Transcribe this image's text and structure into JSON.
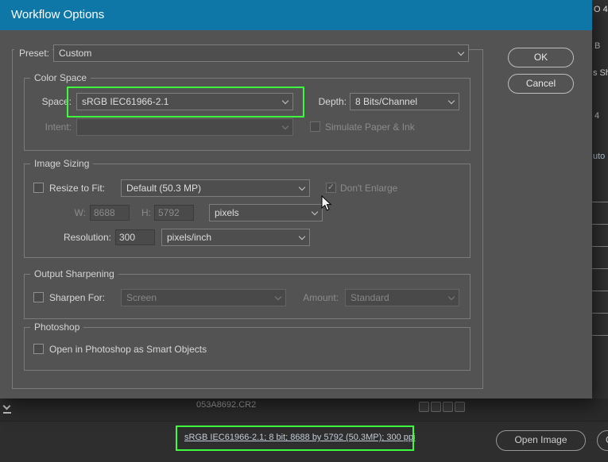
{
  "colors": {
    "title_bar": "#0f76a8",
    "annotation": "#3dfb3d"
  },
  "dialog": {
    "title": "Workflow Options",
    "preset_label": "Preset:",
    "preset_value": "Custom",
    "ok_button": "OK",
    "cancel_button": "Cancel",
    "color_space": {
      "legend": "Color Space",
      "space_label": "Space:",
      "space_value": "sRGB IEC61966-2.1",
      "depth_label": "Depth:",
      "depth_value": "8 Bits/Channel",
      "intent_label": "Intent:",
      "intent_value": "",
      "simulate_label": "Simulate Paper & Ink"
    },
    "image_sizing": {
      "legend": "Image Sizing",
      "resize_label": "Resize to Fit:",
      "resize_value": "Default  (50.3 MP)",
      "dont_enlarge_label": "Don't Enlarge",
      "width_label": "W:",
      "width_value": "8688",
      "height_label": "H:",
      "height_value": "5792",
      "dimension_unit": "pixels",
      "resolution_label": "Resolution:",
      "resolution_value": "300",
      "resolution_unit": "pixels/inch"
    },
    "output_sharpening": {
      "legend": "Output Sharpening",
      "sharpen_label": "Sharpen For:",
      "sharpen_value": "Screen",
      "amount_label": "Amount:",
      "amount_value": "Standard"
    },
    "photoshop": {
      "legend": "Photoshop",
      "smart_objects_label": "Open in Photoshop as Smart Objects"
    }
  },
  "status_bar": {
    "workflow_link": "sRGB IEC61966-2.1; 8 bit; 8688 by 5792 (50.3MP); 300 ppi",
    "open_image_button": "Open Image",
    "cancel_button_partial": "C"
  },
  "filmstrip": {
    "filename": "053A8692.CR2"
  },
  "background_fragments": [
    "O 4",
    "B",
    "s Sh",
    "4",
    "uto"
  ],
  "icons": {
    "check_glyph": "✓"
  }
}
